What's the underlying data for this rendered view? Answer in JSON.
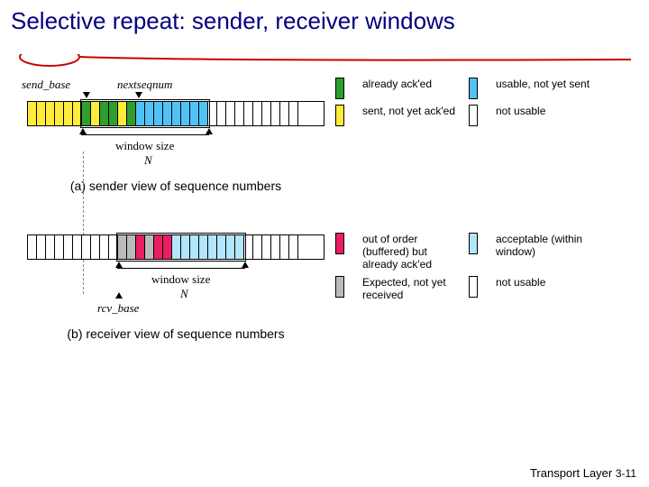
{
  "title": "Selective repeat: sender, receiver windows",
  "labels": {
    "send_base": "send_base",
    "nextseqnum": "nextseqnum",
    "window_size": "window size",
    "N": "N",
    "rcv_base": "rcv_base"
  },
  "captions": {
    "a": "(a) sender view of sequence numbers",
    "b": "(b) receiver view of sequence numbers"
  },
  "legend_sender": {
    "already_acked": "already ack'ed",
    "usable": "usable, not yet sent",
    "sent_not_acked": "sent, not yet ack'ed",
    "not_usable": "not usable"
  },
  "legend_receiver": {
    "out_of_order": "out of order (buffered) but already ack'ed",
    "acceptable": "acceptable (within window)",
    "expected": "Expected, not yet received",
    "not_usable": "not usable"
  },
  "footer": {
    "chapter": "Transport Layer",
    "page": "3-11"
  },
  "colors": {
    "gray": "#bbbbbb",
    "yellow": "#ffeb3b",
    "green": "#2e9e2e",
    "white": "#ffffff",
    "blue": "#4fc3f7",
    "cyan": "#b3e5fc",
    "pink": "#e91e63"
  },
  "chart_data": {
    "type": "table",
    "title": "Selective Repeat sequence-number windows",
    "sender": {
      "N": 14,
      "sequence_states": [
        "acked",
        "acked",
        "acked",
        "acked",
        "acked",
        "acked",
        "sent",
        "acked",
        "sent",
        "sent",
        "acked",
        "sent",
        "usable",
        "usable",
        "usable",
        "usable",
        "usable",
        "usable",
        "usable",
        "usable",
        "not_usable",
        "not_usable",
        "not_usable",
        "not_usable",
        "not_usable",
        "not_usable",
        "not_usable",
        "not_usable",
        "not_usable",
        "not_usable",
        "not_usable"
      ],
      "send_base_index": 6,
      "nextseqnum_index": 12,
      "state_colors": {
        "acked": "yellow",
        "sent": "green",
        "usable": "blue",
        "not_usable": "white"
      }
    },
    "receiver": {
      "N": 14,
      "sequence_states": [
        "delivered",
        "delivered",
        "delivered",
        "delivered",
        "delivered",
        "delivered",
        "delivered",
        "delivered",
        "delivered",
        "delivered",
        "expected",
        "expected",
        "buffered",
        "expected",
        "buffered",
        "buffered",
        "acceptable",
        "acceptable",
        "acceptable",
        "acceptable",
        "acceptable",
        "acceptable",
        "acceptable",
        "acceptable",
        "not_usable",
        "not_usable",
        "not_usable",
        "not_usable",
        "not_usable",
        "not_usable",
        "not_usable"
      ],
      "rcv_base_index": 10,
      "state_colors": {
        "delivered": "white",
        "expected": "gray",
        "buffered": "pink",
        "acceptable": "cyan",
        "not_usable": "white"
      }
    }
  }
}
